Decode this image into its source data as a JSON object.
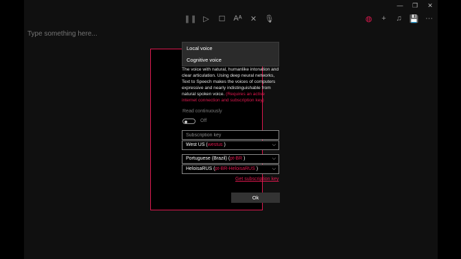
{
  "window": {
    "controls": {
      "minimize": "—",
      "restore": "❐",
      "close": "✕"
    }
  },
  "toolbar": {
    "center_icons": [
      {
        "name": "pause-icon",
        "glyph": "❚❚"
      },
      {
        "name": "play-icon",
        "glyph": "▷"
      },
      {
        "name": "stop-icon",
        "glyph": "☐"
      },
      {
        "name": "text-format-icon",
        "glyph": "Aᴬ"
      },
      {
        "name": "close-icon",
        "glyph": "✕"
      },
      {
        "name": "microphone-icon",
        "glyph": "🎙"
      }
    ],
    "right_icons": [
      {
        "name": "globe-icon",
        "glyph": "◍"
      },
      {
        "name": "add-icon",
        "glyph": "+"
      },
      {
        "name": "music-note-icon",
        "glyph": "♫"
      },
      {
        "name": "save-icon",
        "glyph": "💾"
      },
      {
        "name": "more-icon",
        "glyph": "···"
      }
    ],
    "accent_color": "#e0184f"
  },
  "editor": {
    "placeholder": "Type something here..."
  },
  "dialog": {
    "voice_menu": {
      "options": [
        "Local voice",
        "Cognitive voice"
      ]
    },
    "description": "The voice with natural, humanlike intonation and clear articulation. Using deep neural networks, Text to Speech makes the voices of computers expressive and nearly indistinguishable from natural spoken voice.",
    "warning": "(Requires an active internet connection and subscription key)",
    "read_continuously_label": "Read continuously",
    "toggle_state": "Off",
    "subscription_key_placeholder": "Subscription key",
    "region": {
      "name": "West US (",
      "code": "westus",
      "close": " )"
    },
    "language": {
      "name": "Portuguese (Brazil) (",
      "code": "pt-BR",
      "close": " )"
    },
    "voice": {
      "name": "HeloisaRUS (",
      "code": "pt-BR-HeloisaRUS",
      "close": " )"
    },
    "link": "Get subscription key",
    "ok_label": "Ok"
  }
}
